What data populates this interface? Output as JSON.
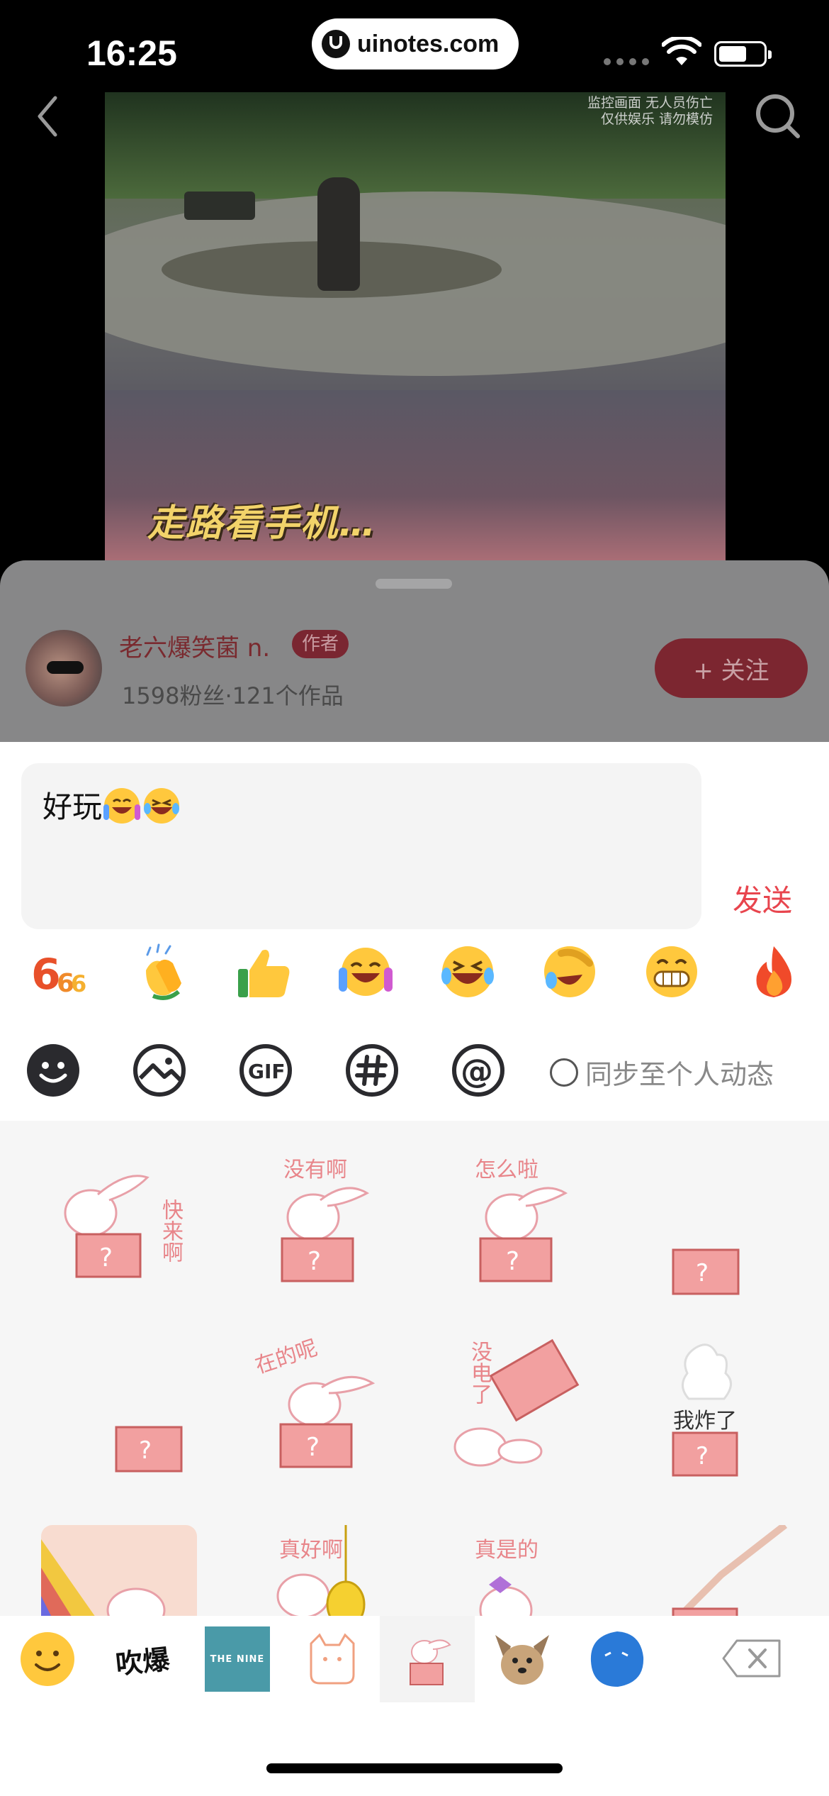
{
  "status_bar": {
    "time": "16:25",
    "url": "uinotes.com"
  },
  "nav": {
    "back_icon": "chevron-left-icon",
    "search_icon": "search-icon"
  },
  "video": {
    "watermark_line1": "监控画面 无人员伤亡",
    "watermark_line2": "仅供娱乐 请勿模仿",
    "caption": "走路看手机…"
  },
  "author": {
    "name": "老六爆笑菌 n.",
    "badge": "作者",
    "stats": "1598粉丝·121个作品",
    "follow_label": "+ 关注"
  },
  "comment": {
    "text": "好玩",
    "inline_emojis": [
      "grin-sweat-emoji",
      "laugh-tears-emoji"
    ],
    "send_label": "发送"
  },
  "quick_emojis": [
    "666-emoji",
    "clap-emoji",
    "thumbs-up-emoji",
    "cheer-emoji",
    "laugh-tears-emoji",
    "rolling-laugh-emoji",
    "grin-emoji",
    "fire-emoji"
  ],
  "tools": {
    "items": [
      "smile-icon",
      "image-icon",
      "gif-icon",
      "hashtag-icon",
      "at-icon"
    ],
    "sync_label": "同步至个人动态"
  },
  "stickers": [
    {
      "caption": "快来啊"
    },
    {
      "caption": "没有啊"
    },
    {
      "caption": "怎么啦"
    },
    {
      "caption": ""
    },
    {
      "caption": ""
    },
    {
      "caption": "在的呢"
    },
    {
      "caption": "没电了"
    },
    {
      "caption": "我炸了"
    },
    {
      "caption": ""
    },
    {
      "caption": "真好啊"
    },
    {
      "caption": "真是的"
    },
    {
      "caption": ""
    }
  ],
  "sticker_tabs": [
    "smile-tab-icon",
    "吹爆",
    "THE NINE",
    "cat-tab-icon",
    "bunny-tab-icon",
    "dog-tab-icon",
    "blue-blob-tab-icon"
  ],
  "colors": {
    "accent": "#e8454e",
    "overlay": "#878788"
  }
}
